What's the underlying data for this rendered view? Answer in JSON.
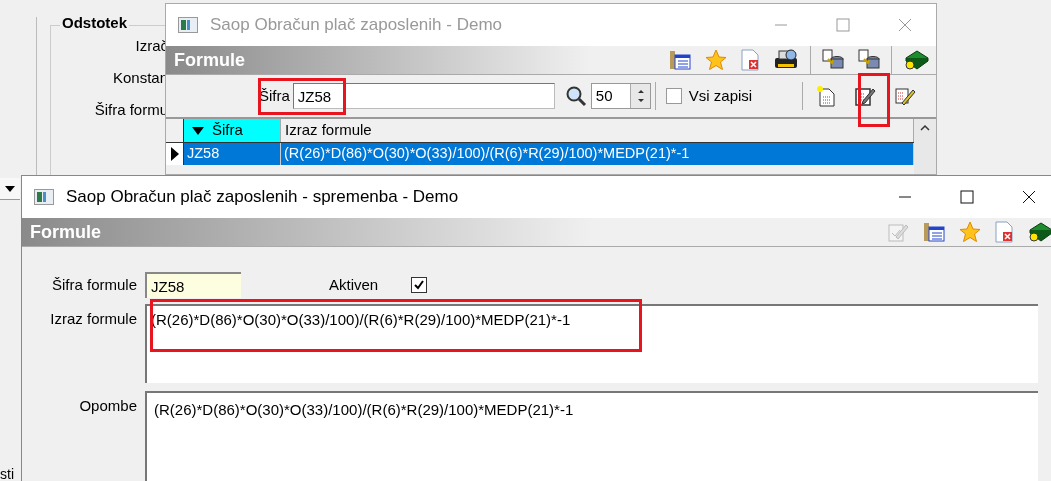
{
  "background_window": {
    "group_title": "Odstotek",
    "labels": [
      "Izrač",
      "Konstan",
      "Šifra formu"
    ],
    "bottom_label": "sti"
  },
  "list_window": {
    "title": "Saop Obračun plač zaposlenih - Demo",
    "active": false,
    "header": "Formule",
    "search": {
      "label": "Šifra",
      "value": "JZ58"
    },
    "page_size": "50",
    "show_all": {
      "label": "Vsi zapisi",
      "checked": false
    },
    "table": {
      "columns": [
        {
          "label": "Šifra",
          "sorted": true
        },
        {
          "label": "Izraz formule",
          "sorted": false
        }
      ],
      "rows": [
        {
          "cells": [
            "JZ58",
            "(R(26)*D(86)*O(30)*O(33)/100)/(R(6)*R(29)/100)*MEDP(21)*-1"
          ],
          "selected": true
        }
      ]
    }
  },
  "edit_window": {
    "title": "Saop Obračun plač zaposlenih - spremenba - Demo",
    "active": true,
    "header": "Formule",
    "code": {
      "label": "Šifra formule",
      "value": "JZ58"
    },
    "active_flag": {
      "label": "Aktiven",
      "checked": true
    },
    "expression": {
      "label": "Izraz formule",
      "value": "(R(26)*D(86)*O(30)*O(33)/100)/(R(6)*R(29)/100)*MEDP(21)*-1"
    },
    "notes": {
      "label": "Opombe",
      "value": "(R(26)*D(86)*O(30)*O(33)/100)/(R(6)*R(29)/100)*MEDP(21)*-1"
    }
  }
}
